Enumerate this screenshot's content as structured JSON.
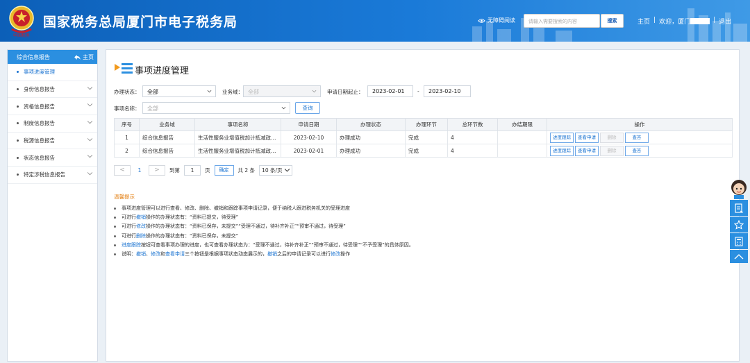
{
  "header": {
    "title": "国家税务总局厦门市电子税务局",
    "accessibility": "无障碍阅读",
    "search_placeholder": "请输入需要搜索的内容",
    "search_button": "搜索",
    "home": "主页",
    "separator": "|",
    "welcome": "欢迎，厦门",
    "logout": "退出"
  },
  "sidebar": {
    "section": "综合信息报告",
    "home": "主页",
    "items": [
      {
        "label": "事项进度管理"
      },
      {
        "label": "身份信息报告"
      },
      {
        "label": "资格信息报告"
      },
      {
        "label": "制度信息报告"
      },
      {
        "label": "税源信息报告"
      },
      {
        "label": "状态信息报告"
      },
      {
        "label": "特定涉税信息报告"
      }
    ]
  },
  "main": {
    "title": "事项进度管理",
    "filters": {
      "status_label": "办理状态：",
      "status_value": "全部",
      "domain_label": "业务域：",
      "domain_value": "全部",
      "date_label": "申请日期起止：",
      "date_from": "2023-02-01",
      "date_sep": "-",
      "date_to": "2023-02-10",
      "item_label": "事项名称：",
      "item_value": "全部",
      "query_button": "查询"
    },
    "table": {
      "headers": [
        "序号",
        "业务域",
        "事项名称",
        "申请日期",
        "办理状态",
        "办理环节",
        "总环节数",
        "办结期限",
        "操作"
      ],
      "rows": [
        {
          "no": "1",
          "domain": "综合信息报告",
          "item": "生活性服务业增值税加计抵减政策声明",
          "date": "2023-02-10",
          "status": "办理成功",
          "stage": "完成",
          "total": "4",
          "deadline": ""
        },
        {
          "no": "2",
          "domain": "综合信息报告",
          "item": "生活性服务业增值税加计抵减政策声明",
          "date": "2023-02-01",
          "status": "办理成功",
          "stage": "完成",
          "total": "4",
          "deadline": ""
        }
      ],
      "actions": {
        "track": "进度跟踪",
        "view": "查看申请",
        "delete": "删除",
        "check": "查答"
      }
    },
    "pager": {
      "prev": "<",
      "page": "1",
      "next": ">",
      "goto_label": "到第",
      "goto_value": "1",
      "page_unit": "页",
      "confirm": "确定",
      "total": "共 2 条",
      "page_size": "10 条/页"
    },
    "tips": {
      "title": "温馨提示",
      "line1": "事项进度管理可以进行查看、修改、删除、撤销和跟踪事项申请记录，便于纳税人跟进税务机关的受理进度",
      "line2_a": "可进行",
      "line2_hl": "撤销",
      "line2_b": "操作的办理状态有：“资料已提交，待受理”",
      "line3_a": "可进行",
      "line3_hl": "修改",
      "line3_b": "操作的办理状态有：“资料已保存，未提交”“受理不通过，待补齐补正”“预审不通过，待受理”",
      "line4_a": "可进行",
      "line4_hl": "删除",
      "line4_b": "操作的办理状态有：“资料已保存，未提交”",
      "line5_hl": "进度跟踪",
      "line5_b": "按钮可查看事项办理的进度，也可查看办理状态为：“受理不通过，待补齐补正”“预审不通过，待受理”“不予受理”的具体原因。",
      "line6_a": "说明：",
      "line6_hl1": "撤销",
      "line6_s1": "、",
      "line6_hl2": "修改",
      "line6_s2": "和",
      "line6_hl3": "查看申请",
      "line6_b": "三个按钮是根据事项状态动态展示的，",
      "line6_hl4": "撤销",
      "line6_c": "之后的申请记录可以进行",
      "line6_hl5": "修改",
      "line6_d": "操作"
    }
  },
  "colors": {
    "header": "#1a73d1",
    "accent": "#2b8fe0",
    "tip_title": "#e4841c"
  },
  "icons": [
    "tax-emblem-icon",
    "eye-icon",
    "back-arrow-icon",
    "chevron-down-icon",
    "document-list-icon",
    "assistant-avatar-icon",
    "form-icon",
    "star-icon",
    "calculator-icon",
    "chevron-up-icon"
  ]
}
